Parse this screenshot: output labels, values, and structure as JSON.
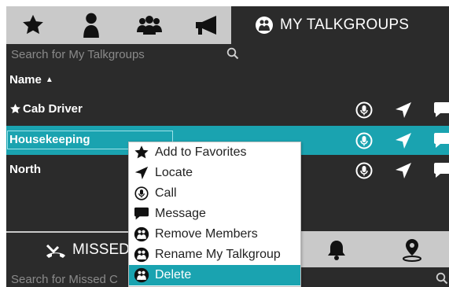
{
  "top_tabs": {
    "icons": [
      "star-icon",
      "person-icon",
      "group-icon",
      "megaphone-icon"
    ],
    "active_label": "MY TALKGROUPS"
  },
  "search": {
    "placeholder": "Search for My Talkgroups"
  },
  "list": {
    "header": "Name",
    "sort_indicator": "▲",
    "rows": [
      {
        "name": "Cab Driver",
        "favorite": true,
        "selected": false
      },
      {
        "name": "Housekeeping",
        "favorite": false,
        "selected": true
      },
      {
        "name": "North",
        "favorite": false,
        "selected": false
      }
    ]
  },
  "bottom": {
    "missed_label": "MISSED C",
    "search_placeholder": "Search for Missed C"
  },
  "context_menu": {
    "items": [
      {
        "label": "Add to Favorites",
        "icon": "star-icon"
      },
      {
        "label": "Locate",
        "icon": "locate-arrow-icon"
      },
      {
        "label": "Call",
        "icon": "mic-icon"
      },
      {
        "label": "Message",
        "icon": "chat-icon"
      },
      {
        "label": "Remove Members",
        "icon": "group-icon"
      },
      {
        "label": "Rename My Talkgroup",
        "icon": "group-icon"
      },
      {
        "label": "Delete",
        "icon": "group-icon"
      }
    ],
    "highlighted_index": 6
  },
  "colors": {
    "accent": "#1aa3b0",
    "panel": "#2b2b2b",
    "tabbar": "#c9c9c9"
  }
}
